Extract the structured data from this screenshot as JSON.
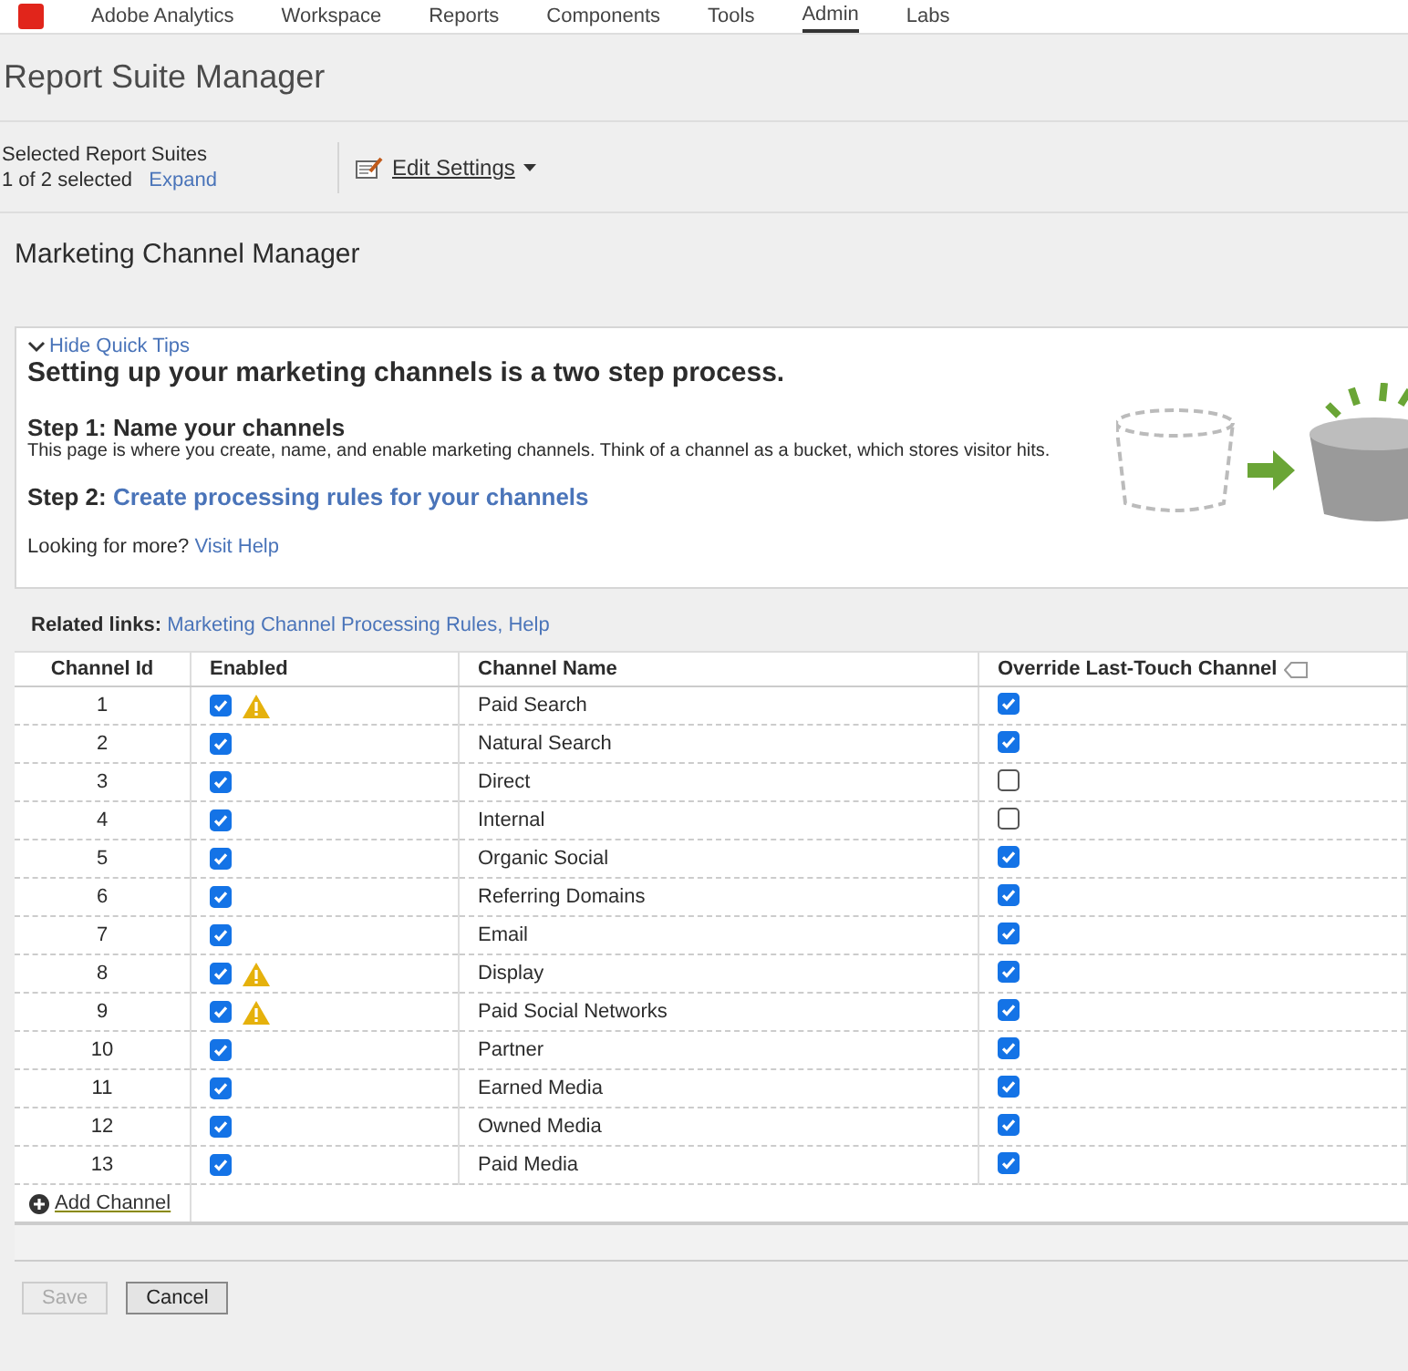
{
  "nav": {
    "logo": "Adobe Analytics",
    "items": [
      {
        "label": "Workspace",
        "selected": false
      },
      {
        "label": "Reports",
        "selected": false
      },
      {
        "label": "Components",
        "selected": false
      },
      {
        "label": "Tools",
        "selected": false
      },
      {
        "label": "Admin",
        "selected": true
      },
      {
        "label": "Labs",
        "selected": false
      }
    ]
  },
  "page_title": "Report Suite Manager",
  "toolbar": {
    "label": "Selected Report Suites",
    "count": "1 of 2 selected",
    "expand": "Expand",
    "edit_settings": "Edit Settings"
  },
  "section_title": "Marketing Channel Manager",
  "quick_tips": {
    "toggle": "Hide Quick Tips",
    "heading": "Setting up your marketing channels is a two step process.",
    "step1_label": "Step 1: Name your channels",
    "step1_text": "This page is where you create, name, and enable marketing channels. Think of a channel as a bucket, which stores visitor hits.",
    "step2_label": "Step 2:",
    "step2_link": "Create processing rules for your channels",
    "more_text": "Looking for more?",
    "more_link": "Visit Help"
  },
  "related_links": {
    "label": "Related links:",
    "separator": ",",
    "links": [
      "Marketing Channel Processing Rules",
      "Help"
    ]
  },
  "table": {
    "columns": [
      "Channel Id",
      "Enabled",
      "Channel Name",
      "Override Last-Touch Channel"
    ],
    "rows": [
      {
        "id": "1",
        "enabled": true,
        "warning": true,
        "name": "Paid Search",
        "override": true
      },
      {
        "id": "2",
        "enabled": true,
        "warning": false,
        "name": "Natural Search",
        "override": true
      },
      {
        "id": "3",
        "enabled": true,
        "warning": false,
        "name": "Direct",
        "override": false
      },
      {
        "id": "4",
        "enabled": true,
        "warning": false,
        "name": "Internal",
        "override": false
      },
      {
        "id": "5",
        "enabled": true,
        "warning": false,
        "name": "Organic Social",
        "override": true
      },
      {
        "id": "6",
        "enabled": true,
        "warning": false,
        "name": "Referring Domains",
        "override": true
      },
      {
        "id": "7",
        "enabled": true,
        "warning": false,
        "name": "Email",
        "override": true
      },
      {
        "id": "8",
        "enabled": true,
        "warning": true,
        "name": "Display",
        "override": true
      },
      {
        "id": "9",
        "enabled": true,
        "warning": true,
        "name": "Paid Social Networks",
        "override": true
      },
      {
        "id": "10",
        "enabled": true,
        "warning": false,
        "name": "Partner",
        "override": true
      },
      {
        "id": "11",
        "enabled": true,
        "warning": false,
        "name": "Earned Media",
        "override": true
      },
      {
        "id": "12",
        "enabled": true,
        "warning": false,
        "name": "Owned Media",
        "override": true
      },
      {
        "id": "13",
        "enabled": true,
        "warning": false,
        "name": "Paid Media",
        "override": true
      }
    ],
    "add_channel": "Add Channel"
  },
  "buttons": [
    {
      "label": "Save",
      "disabled": true
    },
    {
      "label": "Cancel",
      "disabled": false
    }
  ]
}
